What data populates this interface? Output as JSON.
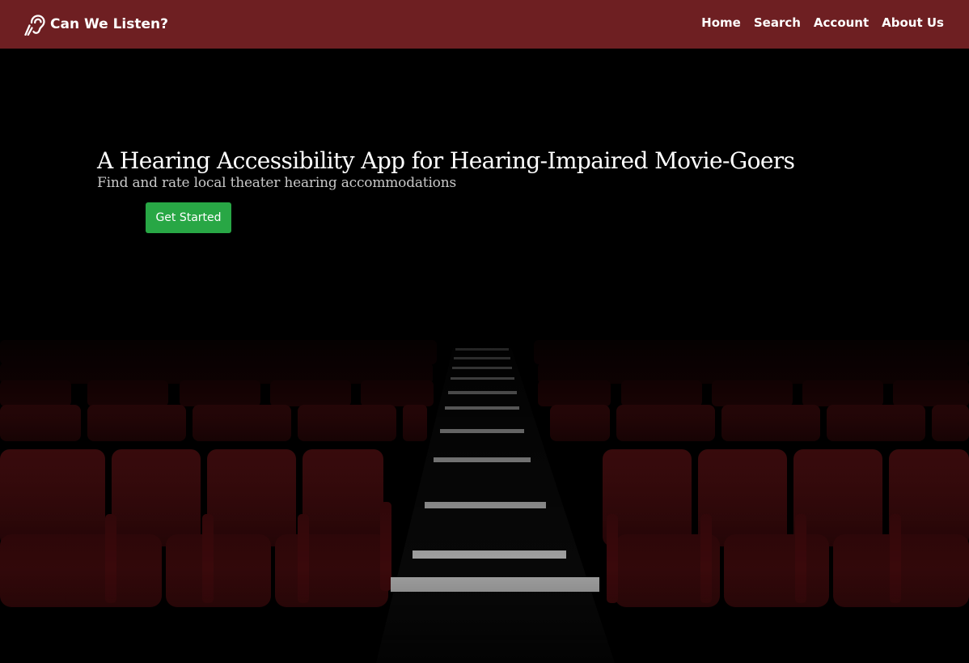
{
  "navbar": {
    "brand": "Can We Listen?",
    "brand_icon": "hearing-icon",
    "links": [
      "Home",
      "Search",
      "Account",
      "About Us"
    ],
    "background_color": "#6e1f22"
  },
  "hero": {
    "title": "A Hearing Accessibility App for Hearing-Impaired Movie-Goers",
    "subtitle": "Find and rate local theater hearing accommodations",
    "cta_label": "Get Started",
    "cta_color": "#28a745",
    "background_image": "dark movie theater with red seats"
  }
}
